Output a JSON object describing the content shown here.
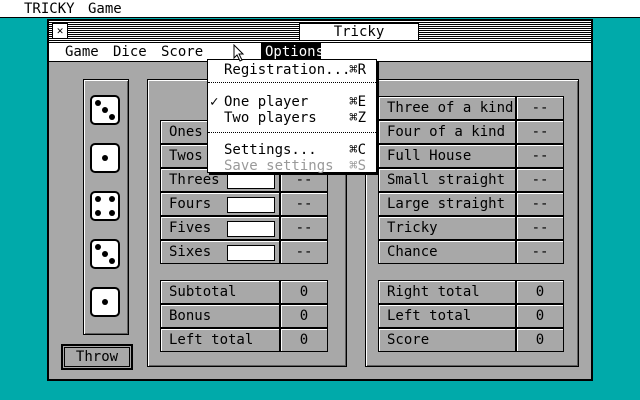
{
  "desktop_menu": [
    "TRICKY",
    "Game"
  ],
  "window": {
    "title": "Tricky"
  },
  "app_menu": [
    "Game",
    "Dice",
    "Score",
    "Options"
  ],
  "options_menu": {
    "registration": {
      "label": "Registration...",
      "key": "⌘R"
    },
    "one_player": {
      "label": "One player",
      "key": "⌘E",
      "checked": "✓"
    },
    "two_players": {
      "label": "Two players",
      "key": "⌘Z"
    },
    "settings": {
      "label": "Settings...",
      "key": "⌘C"
    },
    "save_settings": {
      "label": "Save settings",
      "key": "⌘S"
    }
  },
  "dice": [
    3,
    1,
    4,
    3,
    1
  ],
  "left_upper": [
    {
      "label": "Ones",
      "value": "--"
    },
    {
      "label": "Twos",
      "value": "--"
    },
    {
      "label": "Threes",
      "value": "--"
    },
    {
      "label": "Fours",
      "value": "--"
    },
    {
      "label": "Fives",
      "value": "--"
    },
    {
      "label": "Sixes",
      "value": "--"
    }
  ],
  "left_totals": [
    {
      "label": "Subtotal",
      "value": "0"
    },
    {
      "label": "Bonus",
      "value": "0"
    },
    {
      "label": "Left total",
      "value": "0"
    }
  ],
  "right_upper": [
    {
      "label": "Three of a kind",
      "value": "--"
    },
    {
      "label": "Four of a kind",
      "value": "--"
    },
    {
      "label": "Full House",
      "value": "--"
    },
    {
      "label": "Small straight",
      "value": "--"
    },
    {
      "label": "Large straight",
      "value": "--"
    },
    {
      "label": "Tricky",
      "value": "--"
    },
    {
      "label": "Chance",
      "value": "--"
    }
  ],
  "right_totals": [
    {
      "label": "Right total",
      "value": "0"
    },
    {
      "label": "Left total",
      "value": "0"
    },
    {
      "label": "Score",
      "value": "0"
    }
  ],
  "throw_button": "Throw"
}
